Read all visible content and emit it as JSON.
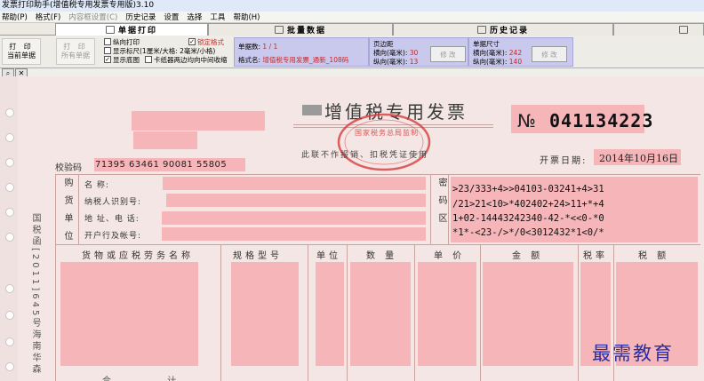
{
  "app": {
    "title": "发票打印助手(增值税专用发票专用版)3.10"
  },
  "menu": [
    {
      "label": "帮助(P)",
      "disabled": false
    },
    {
      "label": "格式(F)",
      "disabled": false
    },
    {
      "label": "内容框设置(C)",
      "disabled": true
    },
    {
      "label": "历史记录",
      "disabled": false
    },
    {
      "label": "设置",
      "disabled": false
    },
    {
      "label": "选择",
      "disabled": false
    },
    {
      "label": "工具",
      "disabled": false
    },
    {
      "label": "帮助(H)",
      "disabled": false
    }
  ],
  "tabs": [
    {
      "label": "单据打印",
      "active": true
    },
    {
      "label": "批量数据",
      "active": false
    },
    {
      "label": "历史记录",
      "active": false
    },
    {
      "label": "",
      "active": false
    }
  ],
  "toolbar": {
    "print_current": {
      "line1": "打 印",
      "line2": "当前单据"
    },
    "print_all": {
      "line1": "打 印",
      "line2": "所有单据"
    },
    "checks": {
      "vertical_print": {
        "label": "纵向打印",
        "checked": false
      },
      "show_ruler": {
        "label": "显示标尺(1厘米/大格: 2毫米/小格)",
        "checked": false
      },
      "show_background": {
        "label": "显示底图",
        "checked": true
      },
      "lock_format": {
        "label": "锁定格式",
        "checked": true
      },
      "card_pos": {
        "label": "卡纸器两边均向中间收缩",
        "checked": false
      }
    },
    "info": {
      "count_label": "单据数:",
      "count_value": "1 / 1",
      "format_label": "格式名:",
      "format_value": "增值税专用发票_通新_108码",
      "margin_title": "页边距",
      "margin_h_label": "横向(毫米):",
      "margin_h_value": "30",
      "margin_v_label": "纵向(毫米):",
      "margin_v_value": "13",
      "margin_btn": "修 改",
      "size_title": "单据尺寸",
      "size_h_label": "横向(毫米):",
      "size_h_value": "242",
      "size_v_label": "纵向(毫米):",
      "size_v_value": "140",
      "size_btn": "修 改"
    }
  },
  "invoice": {
    "title": "增值税专用发票",
    "subtitle": "此联不作报销、扣税凭证使用",
    "stamp_text": "国家税务总局监制",
    "no_label": "№",
    "no_value": "041134223",
    "date_label": "开票日期:",
    "date_value": "2014年10月16日",
    "check_code_label": "校验码",
    "check_code_value": "71395 63461 90081 55805",
    "buyer_vertical": "购货单位",
    "buyer_fields": [
      "名 称:",
      "纳税人识别号:",
      "地 址、电 话:",
      "开户行及帐号:"
    ],
    "cipher_vertical": "密码区",
    "cipher_lines": [
      ">23/333+4>>04103-03241+4>31",
      "/21>21<10>*402402+24>11+*+4",
      "1+02-14443242340-42-*<<0-*0",
      "*1*-<23-/>*/0<3012432*1<0/*"
    ],
    "columns": [
      "货物或应税劳务名称",
      "规格型号",
      "单位",
      "数 量",
      "单 价",
      "金 额",
      "税率",
      "税 额"
    ],
    "side_text": "国税函[2011]645号海南华森",
    "bottom_partial": "合 计"
  },
  "watermark": "最需教育"
}
